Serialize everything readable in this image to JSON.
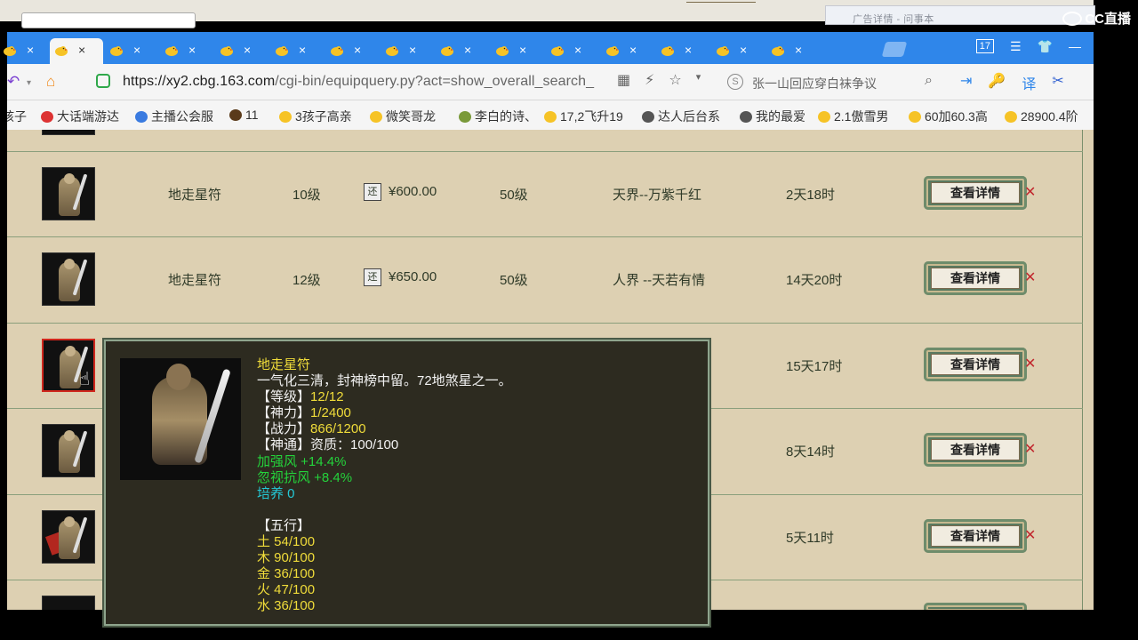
{
  "background_window": {
    "title": "广告详情 - 问事本"
  },
  "overlay_logo": "CC直播",
  "browser": {
    "tab_close_glyph": "×",
    "tab_count": 15,
    "active_tab_index": 1,
    "toolbar_badge": "17",
    "url": {
      "host": "https://xy2.cbg.163.com",
      "path": "/cgi-bin/equipquery.py?act=show_overall_search_"
    },
    "search_text": "张一山回应穿白袜争议",
    "bookmarks": [
      "孩子",
      "大话端游达",
      "主播公会服",
      "11",
      "3孩子高亲",
      "微笑哥龙",
      "李白的诗、",
      "17,2飞升19",
      "达人后台系",
      "我的最爱",
      "2.1傲雪男",
      "60加60.3高",
      "28900.4阶"
    ]
  },
  "listing": {
    "detail_button_label": "查看详情",
    "refund_tag": "还",
    "rows": [
      {
        "name": "地走星符",
        "level": "10级",
        "price": "¥600.00",
        "req_level": "50级",
        "server": "天界--万紫千红",
        "time_left": "2天18时"
      },
      {
        "name": "地走星符",
        "level": "12级",
        "price": "¥650.00",
        "req_level": "50级",
        "server": "人界 --天若有情",
        "time_left": "14天20时"
      },
      {
        "name": "",
        "level": "",
        "price": "",
        "req_level": "",
        "server": "",
        "time_left": "15天17时"
      },
      {
        "name": "",
        "level": "",
        "price": "",
        "req_level": "",
        "server": "",
        "time_left": "8天14时"
      },
      {
        "name": "",
        "level": "",
        "price": "",
        "req_level": "",
        "server": "",
        "time_left": "5天11时"
      }
    ]
  },
  "tooltip": {
    "name": "地走星符",
    "desc": "一气化三清，封神榜中留。72地煞星之一。",
    "grade_label": "【等级】",
    "grade_value": "12/12",
    "shenli_label": "【神力】",
    "shenli_value": "1/2400",
    "zhanli_label": "【战力】",
    "zhanli_value": "866/1200",
    "shentong_label": "【神通】",
    "shentong_value": "资质：100/100",
    "bonus1": "加强风 +14.4%",
    "bonus2": "忽视抗风 +8.4%",
    "peiyang": "培养 0",
    "wuxing_title": "【五行】",
    "wuxing": [
      "土 54/100",
      "木 90/100",
      "金 36/100",
      "火 47/100",
      "水 36/100"
    ]
  }
}
